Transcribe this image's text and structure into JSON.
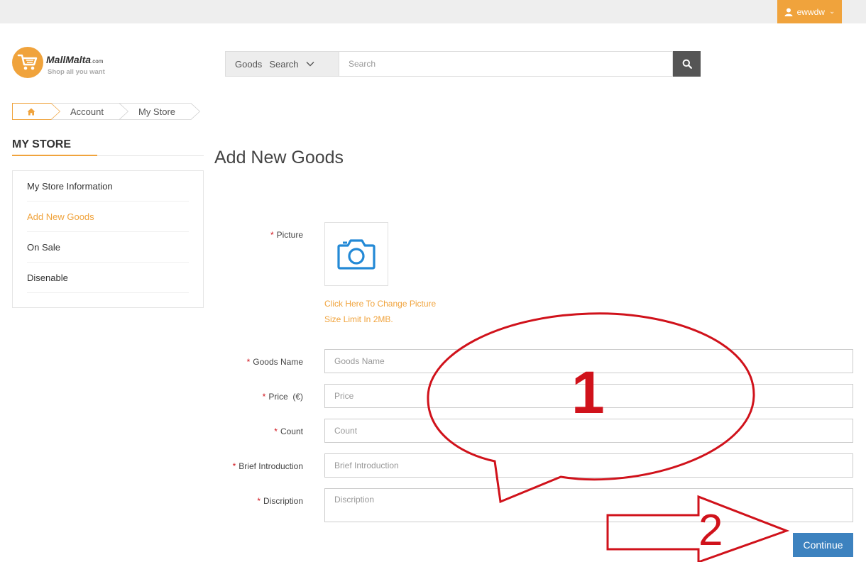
{
  "header": {
    "username": "ewwdw",
    "colors": {
      "accent": "#f0a33c",
      "topbar": "#eeeeee",
      "primary_button": "#3d82bf",
      "required": "#d0121b"
    }
  },
  "logo": {
    "name": "MallMalta",
    "suffix": ".com",
    "tagline": "Shop all you want",
    "icon": "shopping-cart-icon"
  },
  "search": {
    "category": "Goods",
    "category_action": "Search",
    "placeholder": "Search",
    "icon": "search-icon"
  },
  "breadcrumb": {
    "home_icon": "home-icon",
    "items": [
      "Account",
      "My Store"
    ]
  },
  "sidebar": {
    "title": "MY STORE",
    "items": [
      {
        "label": "My Store Information"
      },
      {
        "label": "Add New Goods"
      },
      {
        "label": "On Sale"
      },
      {
        "label": "Disenable"
      }
    ],
    "active_index": 1
  },
  "form": {
    "title": "Add New Goods",
    "required_mark": "*",
    "picture": {
      "label": "Picture",
      "icon": "camera-icon",
      "change_link": "Click Here To Change Picture",
      "size_limit": "Size Limit In 2MB."
    },
    "fields": {
      "goods_name": {
        "label": "Goods Name",
        "placeholder": "Goods Name",
        "value": ""
      },
      "price": {
        "label": "Price  (€)",
        "placeholder": "Price",
        "value": ""
      },
      "count": {
        "label": "Count",
        "placeholder": "Count",
        "value": ""
      },
      "brief": {
        "label": "Brief Introduction",
        "placeholder": "Brief Introduction",
        "value": ""
      },
      "description": {
        "label": "Discription",
        "placeholder": "Discription",
        "value": ""
      }
    },
    "continue_label": "Continue"
  },
  "annotations": {
    "callout_number": "1",
    "arrow_number": "2",
    "color": "#d0121b"
  }
}
